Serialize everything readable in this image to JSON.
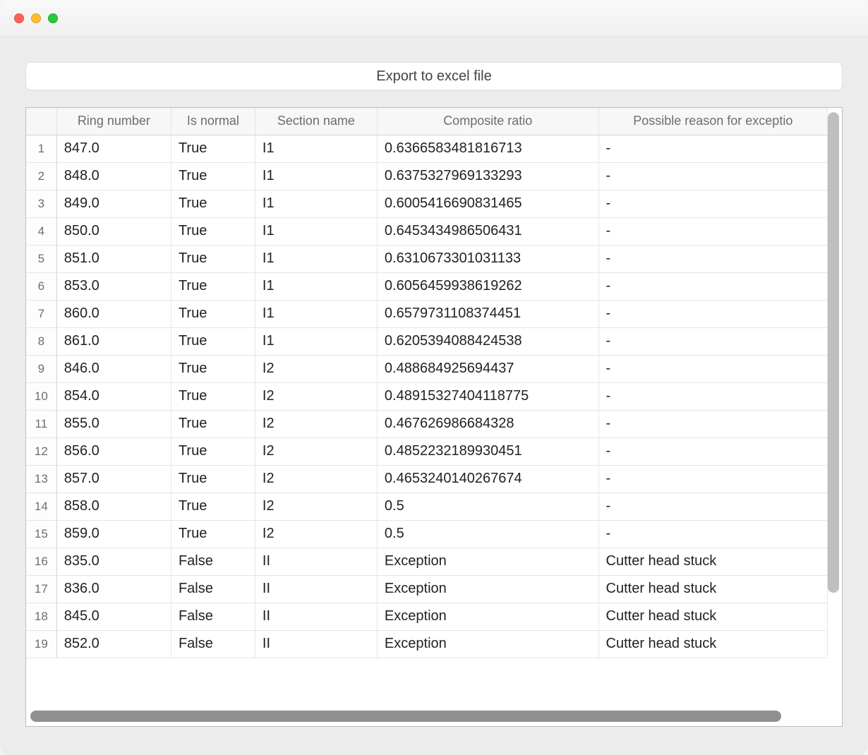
{
  "button": {
    "export_label": "Export to excel file"
  },
  "table": {
    "headers": {
      "ring": "Ring number",
      "normal": "Is normal",
      "section": "Section name",
      "ratio": "Composite ratio",
      "reason": "Possible reason for exceptio"
    },
    "rows": [
      {
        "idx": "1",
        "ring": "847.0",
        "normal": "True",
        "section": "I1",
        "ratio": "0.6366583481816713",
        "reason": "-"
      },
      {
        "idx": "2",
        "ring": "848.0",
        "normal": "True",
        "section": "I1",
        "ratio": "0.6375327969133293",
        "reason": "-"
      },
      {
        "idx": "3",
        "ring": "849.0",
        "normal": "True",
        "section": "I1",
        "ratio": "0.6005416690831465",
        "reason": "-"
      },
      {
        "idx": "4",
        "ring": "850.0",
        "normal": "True",
        "section": "I1",
        "ratio": "0.6453434986506431",
        "reason": "-"
      },
      {
        "idx": "5",
        "ring": "851.0",
        "normal": "True",
        "section": "I1",
        "ratio": "0.6310673301031133",
        "reason": "-"
      },
      {
        "idx": "6",
        "ring": "853.0",
        "normal": "True",
        "section": "I1",
        "ratio": "0.6056459938619262",
        "reason": "-"
      },
      {
        "idx": "7",
        "ring": "860.0",
        "normal": "True",
        "section": "I1",
        "ratio": "0.6579731108374451",
        "reason": "-"
      },
      {
        "idx": "8",
        "ring": "861.0",
        "normal": "True",
        "section": "I1",
        "ratio": "0.6205394088424538",
        "reason": "-"
      },
      {
        "idx": "9",
        "ring": "846.0",
        "normal": "True",
        "section": "I2",
        "ratio": "0.488684925694437",
        "reason": "-"
      },
      {
        "idx": "10",
        "ring": "854.0",
        "normal": "True",
        "section": "I2",
        "ratio": "0.48915327404118775",
        "reason": "-"
      },
      {
        "idx": "11",
        "ring": "855.0",
        "normal": "True",
        "section": "I2",
        "ratio": "0.467626986684328",
        "reason": "-"
      },
      {
        "idx": "12",
        "ring": "856.0",
        "normal": "True",
        "section": "I2",
        "ratio": "0.4852232189930451",
        "reason": "-"
      },
      {
        "idx": "13",
        "ring": "857.0",
        "normal": "True",
        "section": "I2",
        "ratio": "0.4653240140267674",
        "reason": "-"
      },
      {
        "idx": "14",
        "ring": "858.0",
        "normal": "True",
        "section": "I2",
        "ratio": "0.5",
        "reason": "-"
      },
      {
        "idx": "15",
        "ring": "859.0",
        "normal": "True",
        "section": "I2",
        "ratio": "0.5",
        "reason": "-"
      },
      {
        "idx": "16",
        "ring": "835.0",
        "normal": "False",
        "section": "II",
        "ratio": "Exception",
        "reason": "Cutter head stuck"
      },
      {
        "idx": "17",
        "ring": "836.0",
        "normal": "False",
        "section": "II",
        "ratio": "Exception",
        "reason": "Cutter head stuck"
      },
      {
        "idx": "18",
        "ring": "845.0",
        "normal": "False",
        "section": "II",
        "ratio": "Exception",
        "reason": "Cutter head stuck"
      },
      {
        "idx": "19",
        "ring": "852.0",
        "normal": "False",
        "section": "II",
        "ratio": "Exception",
        "reason": "Cutter head stuck"
      }
    ]
  }
}
